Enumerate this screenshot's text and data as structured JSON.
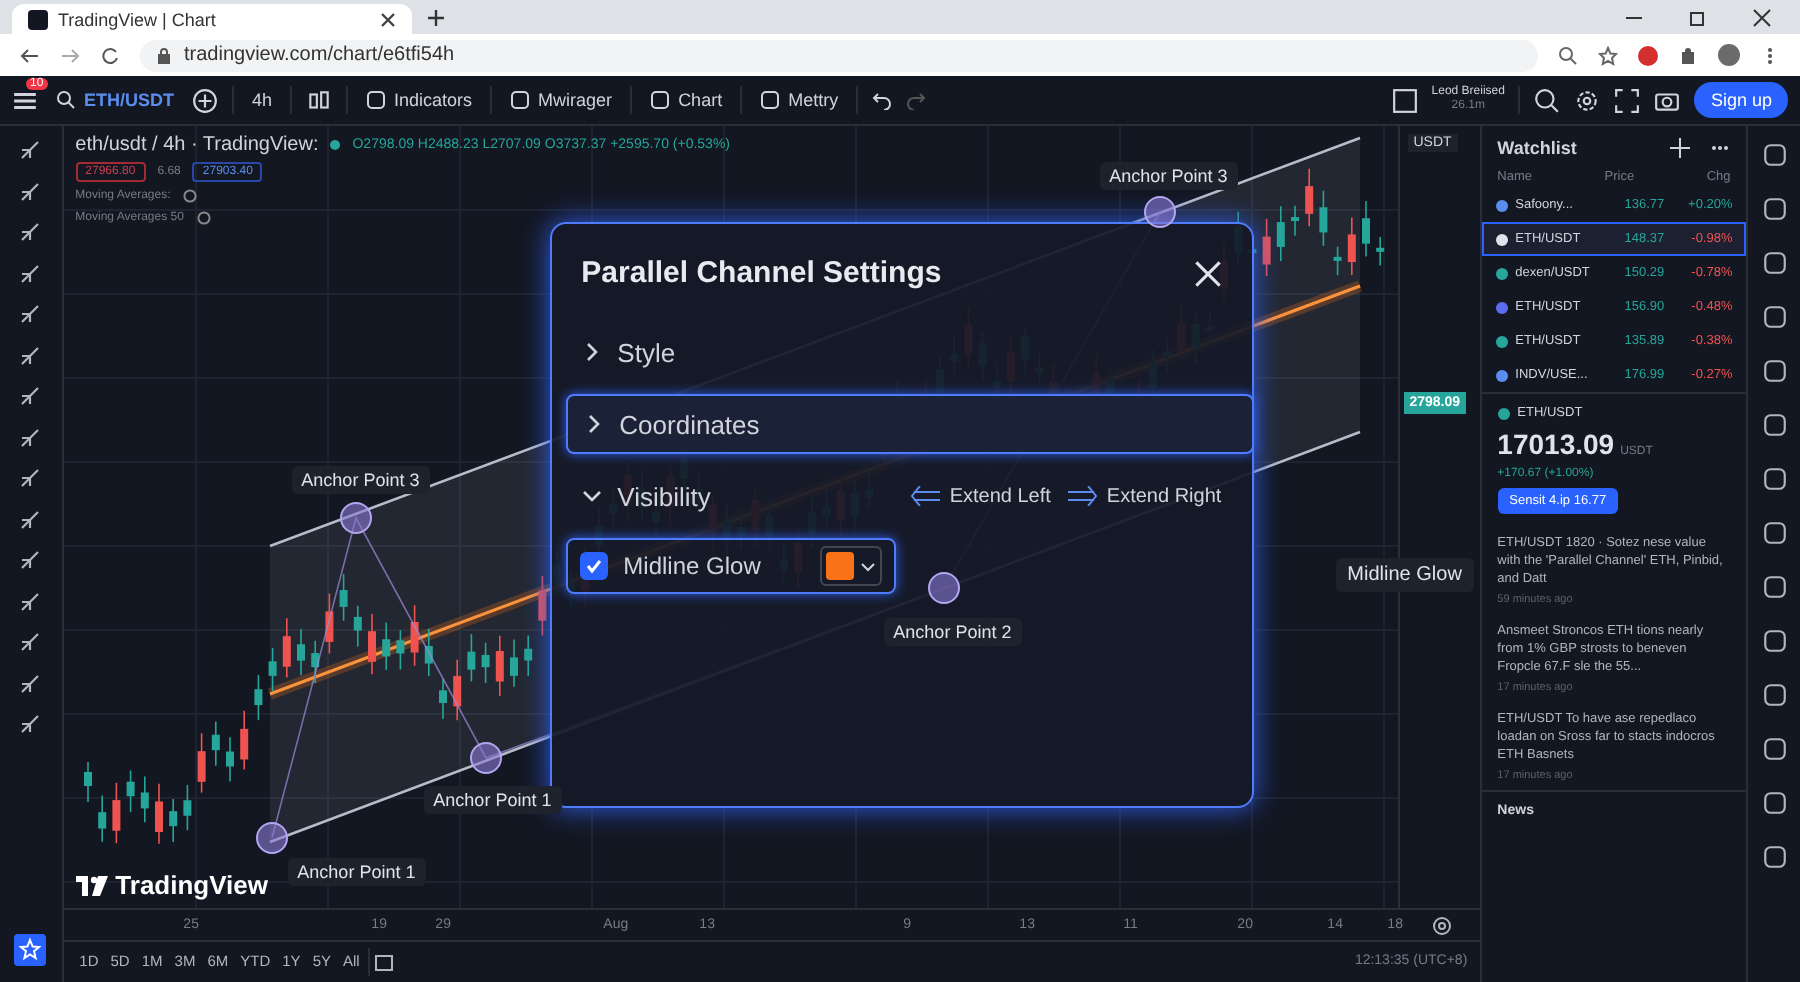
{
  "browser": {
    "tab_title": "TradingView | Chart",
    "url": "tradingview.com/chart/e6tfi54h"
  },
  "toolbar": {
    "badge": "10",
    "symbol": "ETH/USDT",
    "interval": "4h",
    "items": [
      "Indicators",
      "Mwirager",
      "Chart",
      "Mettry"
    ],
    "layout_name": "Leod Breiised",
    "layout_sub": "26.1m",
    "signup": "Sign up"
  },
  "legend": {
    "title": "eth/usdt / 4h · TradingView:",
    "ohlc": "O2798.09 H2488.23 L2707.09 O3737.37 +2595.70 (+0.53%)",
    "sell": "27966.80",
    "spread": "6.68",
    "buy": "27903.40",
    "indicators": [
      "Moving Averages:",
      "Moving Averages 50"
    ]
  },
  "chart": {
    "currency": "USDT",
    "last_price": "2798.09",
    "anchors": [
      {
        "label": "Anchor Point 3"
      },
      {
        "label": "Anchor Point 3"
      },
      {
        "label": "Anchor Point 1"
      },
      {
        "label": "Anchor Point 1"
      },
      {
        "label": "Anchor Point 2"
      }
    ],
    "tooltip": "Midline Glow",
    "watermark": "TradingView",
    "x_labels": [
      "25",
      "19",
      "29",
      "Aug",
      "13",
      "9",
      "13",
      "11",
      "20",
      "14",
      "18"
    ]
  },
  "dialog": {
    "title": "Parallel Channel Settings",
    "sections": [
      {
        "label": "Style",
        "expanded": false,
        "selected": false
      },
      {
        "label": "Coordinates",
        "expanded": false,
        "selected": true
      },
      {
        "label": "Visibility",
        "expanded": true,
        "selected": false,
        "options": [
          "Extend Left",
          "Extend Right"
        ]
      }
    ],
    "checkbox": {
      "label": "Midline Glow",
      "checked": true,
      "color": "#f97316"
    }
  },
  "ranges": [
    "1D",
    "5D",
    "1M",
    "3M",
    "6M",
    "YTD",
    "1Y",
    "5Y",
    "All"
  ],
  "clock": "12:13:35 (UTC+8)",
  "watchlist": {
    "title": "Watchlist",
    "columns": [
      "Name",
      "Price",
      "Chg"
    ],
    "rows": [
      {
        "symbol": "Safoony...",
        "price": "136.77",
        "change": "+0.20%",
        "up": true,
        "color": "#5b8def",
        "selected": false
      },
      {
        "symbol": "ETH/USDT",
        "price": "148.37",
        "change": "-0.98%",
        "up": false,
        "color": "#e0e3eb",
        "selected": true
      },
      {
        "symbol": "dexen/USDT",
        "price": "150.29",
        "change": "-0.78%",
        "up": false,
        "color": "#26a69a",
        "selected": false
      },
      {
        "symbol": "ETH/USDT",
        "price": "156.90",
        "change": "-0.48%",
        "up": false,
        "color": "#5b6cf0",
        "selected": false
      },
      {
        "symbol": "ETH/USDT",
        "price": "135.89",
        "change": "-0.38%",
        "up": false,
        "color": "#26a69a",
        "selected": false
      },
      {
        "symbol": "INDV/USE...",
        "price": "176.99",
        "change": "-0.27%",
        "up": false,
        "color": "#5b8def",
        "selected": false
      }
    ],
    "detail": {
      "symbol": "ETH/USDT",
      "price": "17013.09",
      "unit": "USDT",
      "change": "+170.67 (+1.00%)",
      "button": "Sensit 4.ip 16.77"
    },
    "news": [
      {
        "text": "ETH/USDT 1820 · Sotez nese value with the 'Parallel Channel' ETH, Pinbid, and Datt",
        "time": "59 minutes ago"
      },
      {
        "text": "Ansmeet Stroncos ETH tions nearly from 1% GBP strosts to beneven Fropcle 67.F sle the 55...",
        "time": "17 minutes ago"
      },
      {
        "text": "ETH/USDT To have ase repedlaco loadan on Sross far to stacts indocros ETH Basnets",
        "time": "17 minutes ago"
      }
    ],
    "news_title": "News"
  }
}
